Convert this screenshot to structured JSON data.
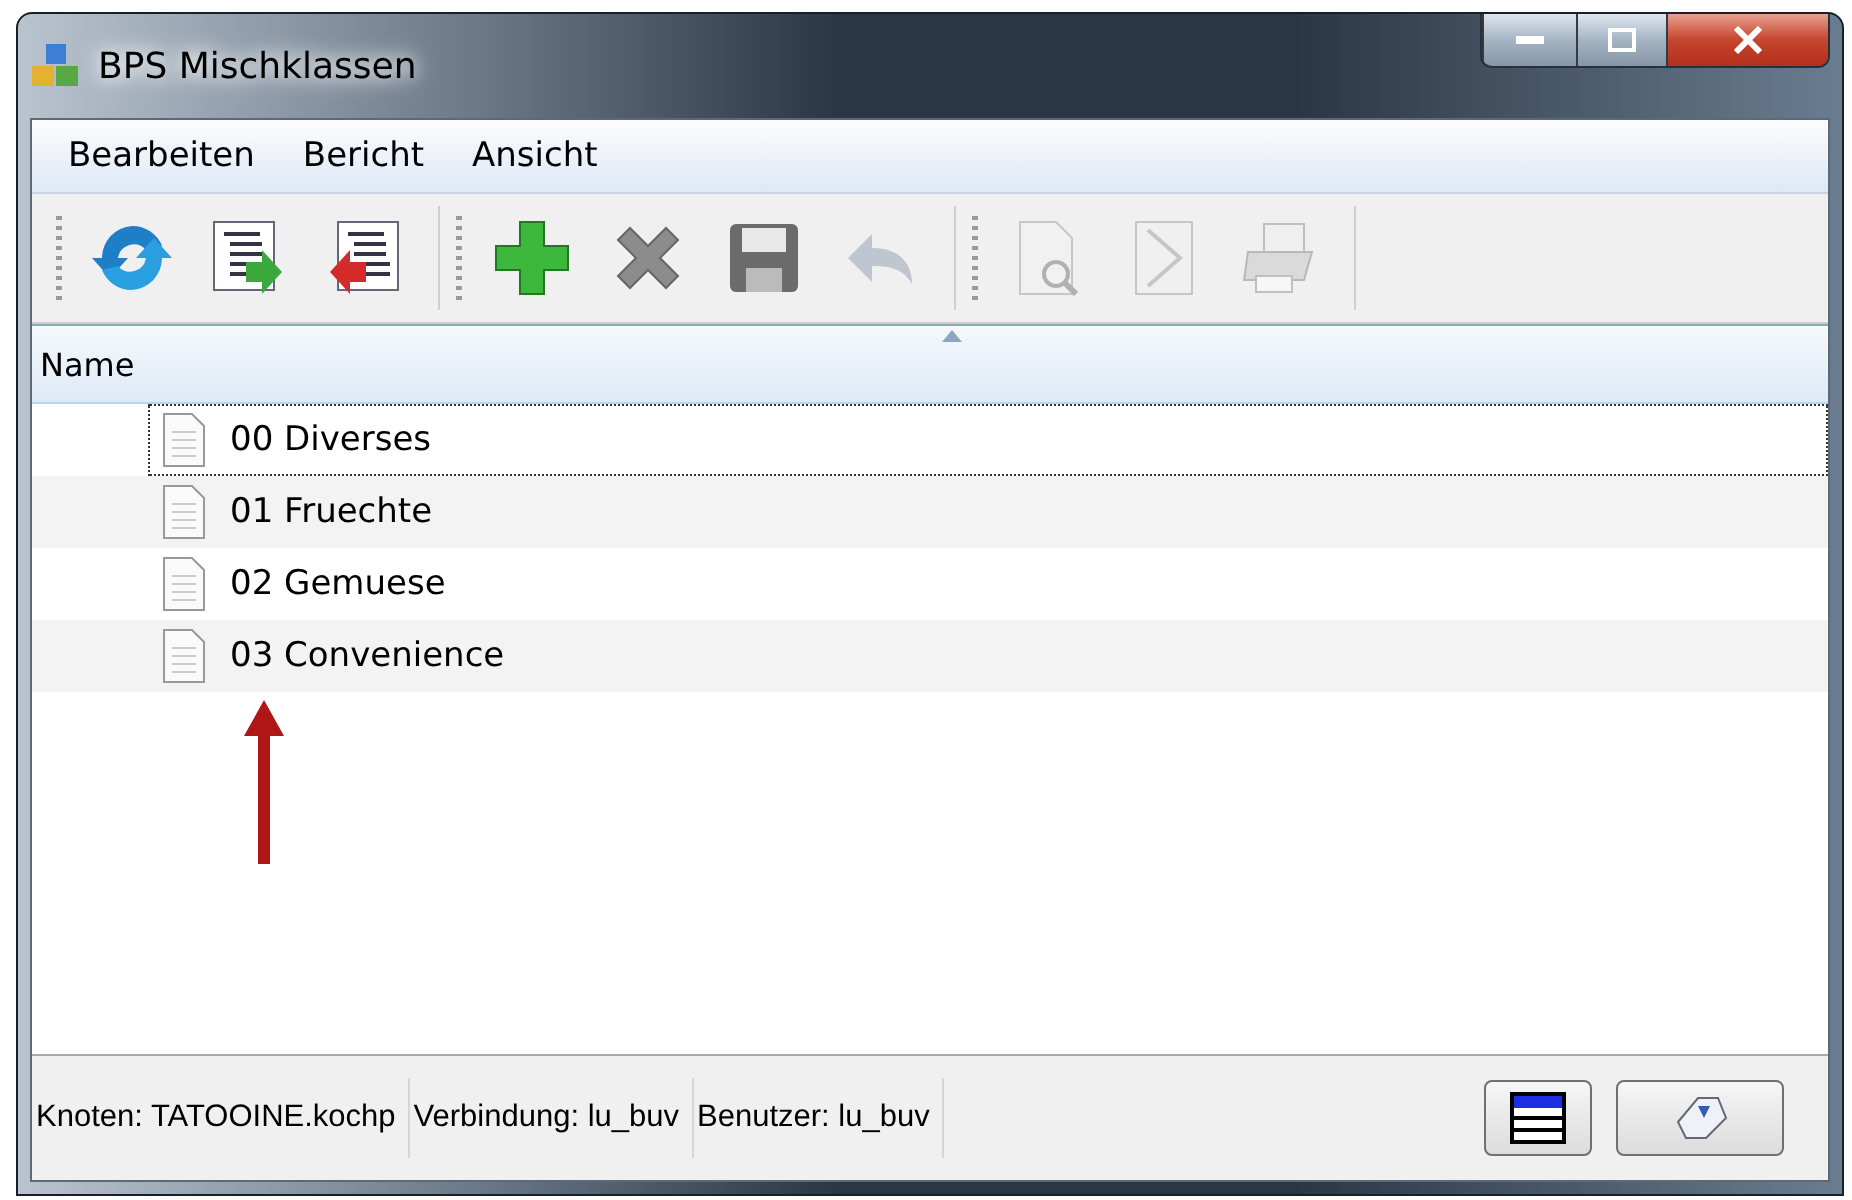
{
  "window": {
    "title": "BPS Mischklassen"
  },
  "menu": [
    "Bearbeiten",
    "Bericht",
    "Ansicht"
  ],
  "toolbar": [
    [
      {
        "kind": "refresh",
        "disabled": false
      },
      {
        "kind": "import",
        "disabled": false
      },
      {
        "kind": "export",
        "disabled": false
      }
    ],
    [
      {
        "kind": "add",
        "disabled": false
      },
      {
        "kind": "delete",
        "disabled": false
      },
      {
        "kind": "save",
        "disabled": false
      },
      {
        "kind": "undo",
        "disabled": true
      }
    ],
    [
      {
        "kind": "preview",
        "disabled": true
      },
      {
        "kind": "pdf",
        "disabled": true
      },
      {
        "kind": "print",
        "disabled": true
      }
    ]
  ],
  "list": {
    "columns": [
      {
        "label": "Name",
        "sorted": true
      }
    ],
    "rows": [
      {
        "name": "00 Diverses",
        "selected": true
      },
      {
        "name": "01 Fruechte",
        "selected": false
      },
      {
        "name": "02 Gemuese",
        "selected": false
      },
      {
        "name": "03 Convenience",
        "selected": false
      }
    ]
  },
  "status_bar": [
    "Knoten: TATOOINE.kochp",
    "Verbindung: lu_buv",
    "Benutzer: lu_buv"
  ]
}
